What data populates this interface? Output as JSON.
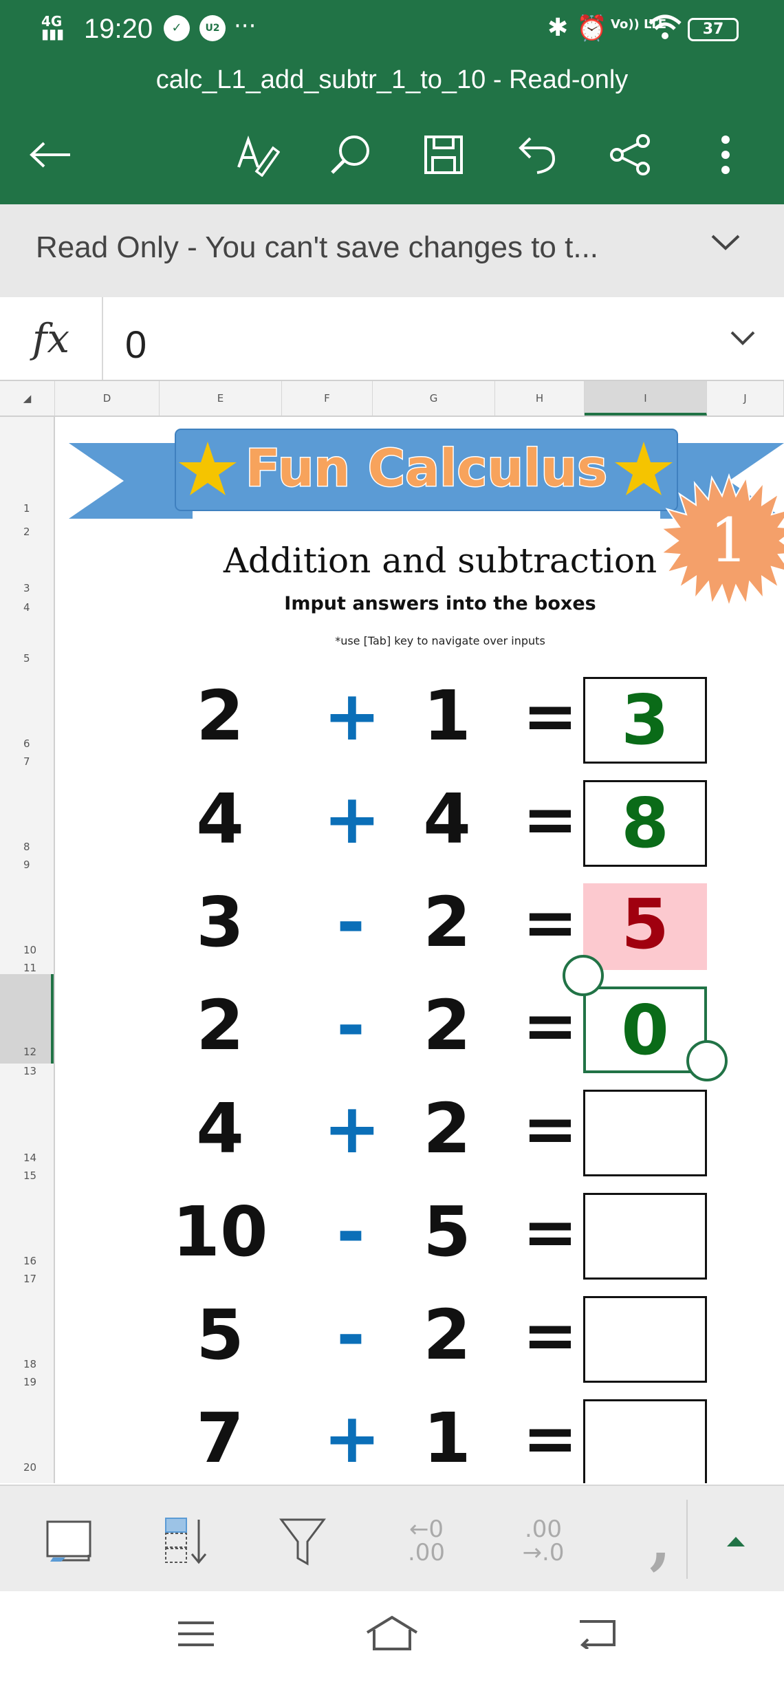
{
  "status": {
    "network": "4G",
    "time": "19:20",
    "battery": "37",
    "volte": "Vo)) LTE"
  },
  "app": {
    "title": "calc_L1_add_subtr_1_to_10 - Read-only"
  },
  "readonly_bar": {
    "text": "Read Only - You can't save changes to t..."
  },
  "formula": {
    "label": "fx",
    "value": "0"
  },
  "columns": [
    "D",
    "E",
    "F",
    "G",
    "H",
    "I",
    "J"
  ],
  "rows": [
    "1",
    "2",
    "3",
    "4",
    "5",
    "6",
    "7",
    "8",
    "9",
    "10",
    "11",
    "12",
    "13",
    "14",
    "15",
    "16",
    "17",
    "18",
    "19",
    "20"
  ],
  "sheet": {
    "banner_title": "Fun Calculus",
    "badge": "1",
    "subtitle": "Addition and subtraction",
    "instruction": "Imput answers into the boxes",
    "note": "*use [Tab] key to navigate over inputs",
    "equations": [
      {
        "a": "2",
        "op": "+",
        "b": "1",
        "eq": "=",
        "answer": "3",
        "state": "correct"
      },
      {
        "a": "4",
        "op": "+",
        "b": "4",
        "eq": "=",
        "answer": "8",
        "state": "correct"
      },
      {
        "a": "3",
        "op": "-",
        "b": "2",
        "eq": "=",
        "answer": "5",
        "state": "wrong"
      },
      {
        "a": "2",
        "op": "-",
        "b": "2",
        "eq": "=",
        "answer": "0",
        "state": "selected"
      },
      {
        "a": "4",
        "op": "+",
        "b": "2",
        "eq": "=",
        "answer": "",
        "state": "empty"
      },
      {
        "a": "10",
        "op": "-",
        "b": "5",
        "eq": "=",
        "answer": "",
        "state": "empty"
      },
      {
        "a": "5",
        "op": "-",
        "b": "2",
        "eq": "=",
        "answer": "",
        "state": "empty"
      },
      {
        "a": "7",
        "op": "+",
        "b": "1",
        "eq": "=",
        "answer": "",
        "state": "empty"
      }
    ]
  },
  "bottom_toolbar": {
    "decrease_decimal_top": "←0",
    "decrease_decimal_bottom": ".00",
    "increase_decimal_top": ".00",
    "increase_decimal_bottom": "→.0",
    "comma": ","
  },
  "colors": {
    "accent": "#217346",
    "operator": "#0b6fb8",
    "correct": "#0a6b18",
    "wrong_bg": "#fcc9cf",
    "wrong_text": "#a0000f",
    "banner": "#5b9bd5",
    "star": "#f5c400",
    "badge": "#f4a06a"
  }
}
